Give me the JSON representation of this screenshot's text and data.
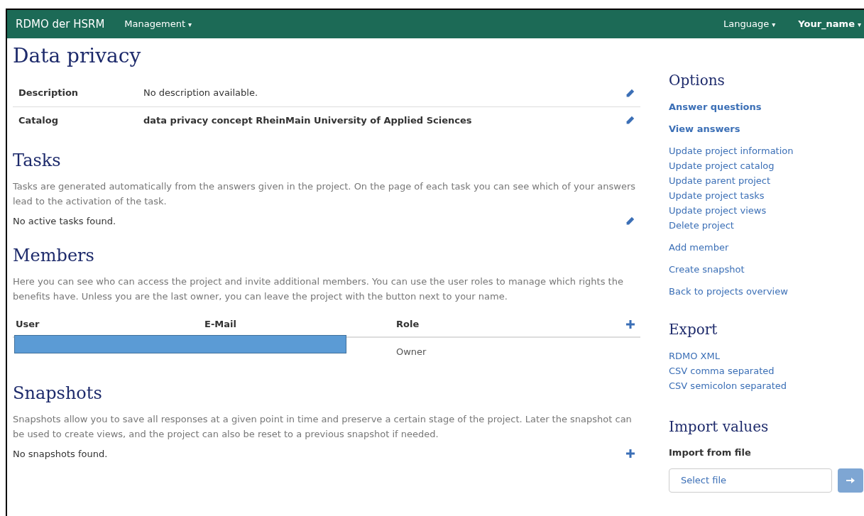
{
  "navbar": {
    "brand": "RDMO der HSRM",
    "left_menus": [
      {
        "label": "Management",
        "caret": "▾",
        "bold": false
      }
    ],
    "right_menus": [
      {
        "label": "Language",
        "caret": "▾",
        "bold": false
      },
      {
        "label": "Your_name",
        "caret": "▾",
        "bold": true
      }
    ]
  },
  "title": "Data privacy",
  "details": [
    {
      "label": "Description",
      "value": "No description available.",
      "bold": false
    },
    {
      "label": "Catalog",
      "value": "data privacy concept RheinMain University of Applied Sciences",
      "bold": true
    }
  ],
  "tasks": {
    "heading": "Tasks",
    "intro": "Tasks are generated automatically from the answers given in the project. On the page of each task you can see which of your answers lead to the activation of the task.",
    "empty": "No active tasks found."
  },
  "members": {
    "heading": "Members",
    "intro": "Here you can see who can access the project and invite additional members. You can use the user roles to manage which rights the benefits have. Unless you are the last owner, you can leave the project with the button next to your name.",
    "columns": [
      "User",
      "E-Mail",
      "Role"
    ],
    "rows": [
      {
        "role": "Owner",
        "redacted": true
      }
    ]
  },
  "snapshots": {
    "heading": "Snapshots",
    "intro": "Snapshots allow you to save all responses at a given point in time and preserve a certain stage of the project. Later the snapshot can be used to create views, and the project can also be reset to a previous snapshot if needed.",
    "empty": "No snapshots found."
  },
  "options": {
    "heading": "Options",
    "groups": [
      [
        {
          "label": "Answer questions",
          "bold": true
        }
      ],
      [
        {
          "label": "View answers",
          "bold": true
        }
      ],
      [
        {
          "label": "Update project information",
          "bold": false
        },
        {
          "label": "Update project catalog",
          "bold": false
        },
        {
          "label": "Update parent project",
          "bold": false
        },
        {
          "label": "Update project tasks",
          "bold": false
        },
        {
          "label": "Update project views",
          "bold": false
        },
        {
          "label": "Delete project",
          "bold": false
        }
      ],
      [
        {
          "label": "Add member",
          "bold": false
        }
      ],
      [
        {
          "label": "Create snapshot",
          "bold": false
        }
      ],
      [
        {
          "label": "Back to projects overview",
          "bold": false
        }
      ]
    ]
  },
  "export": {
    "heading": "Export",
    "links": [
      "RDMO XML",
      "CSV comma separated",
      "CSV semicolon separated"
    ]
  },
  "import": {
    "heading": "Import values",
    "label": "Import from file",
    "placeholder": "Select file"
  }
}
